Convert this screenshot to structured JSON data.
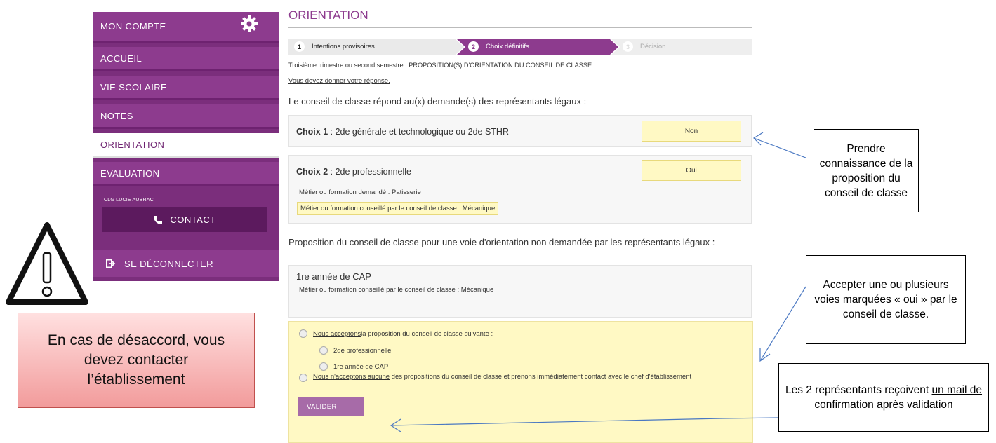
{
  "sidebar": {
    "account": "MON COMPTE",
    "items": [
      "ACCUEIL",
      "VIE SCOLAIRE",
      "NOTES",
      "ORIENTATION",
      "EVALUATION"
    ],
    "school": "CLG LUCIE AUBRAC",
    "contact": "CONTACT",
    "logout": "SE DÉCONNECTER"
  },
  "main": {
    "title": "ORIENTATION",
    "steps": [
      {
        "num": "1",
        "label": "Intentions provisoires"
      },
      {
        "num": "2",
        "label": "Choix définitifs"
      },
      {
        "num": "3",
        "label": "Décision"
      }
    ],
    "intro": "Troisième trimestre ou second semestre : PROPOSITION(S) D'ORIENTATION DU CONSEIL DE CLASSE.",
    "must_answer": "Vous devez donner votre réponse.",
    "council_answers": "Le conseil de classe répond au(x) demande(s) des représentants légaux :",
    "choice1": {
      "prefix": "Choix 1",
      "sep": " : ",
      "text": "2de générale et technologique ou 2de STHR",
      "answer": "Non"
    },
    "choice2": {
      "prefix": "Choix 2",
      "sep": " : ",
      "text": "2de professionnelle",
      "answer": "Oui",
      "requested": "Métier ou formation demandé : Patisserie",
      "advised": "Métier ou formation conseillé par le conseil de classe : Mécanique"
    },
    "unrequested_title": "Proposition du conseil de classe pour une voie d'orientation non demandée par les représentants légaux :",
    "unrequested": {
      "title": "1re année de CAP",
      "advised": "Métier ou formation conseillé par le conseil de classe : Mécanique"
    },
    "accept_link": "Nous acceptons",
    "accept_rest": " la proposition du conseil de classe suivante :",
    "options": [
      "2de professionnelle",
      "1re année de CAP"
    ],
    "refuse_link": "Nous n'acceptons aucune",
    "refuse_rest": " des propositions du conseil de classe et prenons immédiatement contact avec le chef d'établissement",
    "submit": "VALIDER"
  },
  "callouts": {
    "take_note": "Prendre connaissance de la proposition du conseil de classe",
    "accept": "Accepter une ou plusieurs voies marquées «  oui  » par le conseil de classe.",
    "mail_pre": "Les 2 représentants reçoivent ",
    "mail_link": "un mail de confirmation",
    "mail_post": " après validation",
    "warning": "En cas de désaccord, vous devez contacter l’établissement"
  },
  "colors": {
    "brand": "#7b2e7c",
    "highlight": "#fff9c4",
    "warning": "#f29b9b"
  },
  "icons": [
    "gear-icon",
    "phone-icon",
    "logout-icon",
    "warning-triangle-icon",
    "arrow-icon"
  ]
}
